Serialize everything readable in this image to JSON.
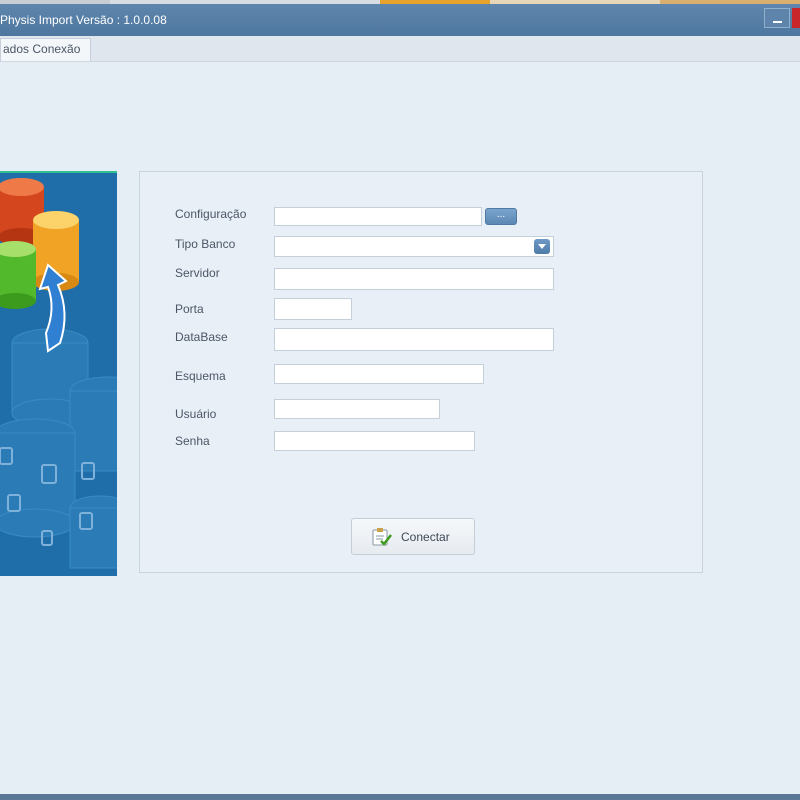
{
  "window": {
    "title": "Physis Import Versão : 1.0.0.08"
  },
  "tabs": [
    {
      "label": "ados Conexão"
    }
  ],
  "form": {
    "configuracao": {
      "label": "Configuração",
      "value": "",
      "browse_label": "..."
    },
    "tipo_banco": {
      "label": "Tipo Banco",
      "value": ""
    },
    "servidor": {
      "label": "Servidor",
      "value": ""
    },
    "porta": {
      "label": "Porta",
      "value": ""
    },
    "database": {
      "label": "DataBase",
      "value": ""
    },
    "esquema": {
      "label": "Esquema",
      "value": ""
    },
    "usuario": {
      "label": "Usuário",
      "value": ""
    },
    "senha": {
      "label": "Senha",
      "value": ""
    }
  },
  "actions": {
    "connect_label": "Conectar"
  },
  "icons": {
    "banner": "database-import-illustration",
    "connect": "connect-checklist-icon",
    "dropdown": "chevron-down-icon",
    "minimize": "minimize-icon",
    "close": "close-icon"
  },
  "colors": {
    "titlebar": "#527ba3",
    "banner": "#1f6ea9",
    "background": "#e5edf5",
    "accent_button": "#5b88b4"
  }
}
